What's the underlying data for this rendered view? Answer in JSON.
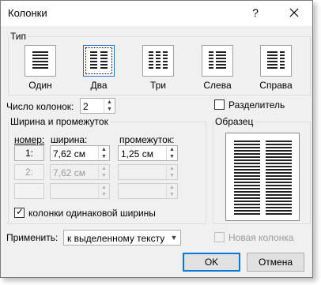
{
  "window": {
    "title": "Колонки",
    "help_label": "?"
  },
  "type_group": {
    "legend": "Тип",
    "presets": [
      {
        "label": "Один"
      },
      {
        "label": "Два",
        "selected": true
      },
      {
        "label": "Три"
      },
      {
        "label": "Слева"
      },
      {
        "label": "Справа"
      }
    ]
  },
  "num_columns": {
    "label": "Число колонок:",
    "value": "2"
  },
  "separator": {
    "label": "Разделитель",
    "checked": false
  },
  "width_group": {
    "legend": "Ширина и промежуток",
    "col_header": "номер:",
    "width_header": "ширина:",
    "spacing_header": "промежуток:",
    "rows": [
      {
        "num": "1:",
        "width": "7,62 см",
        "spacing": "1,25 см",
        "enabled": true
      },
      {
        "num": "2:",
        "width": "7,62 см",
        "spacing": "",
        "enabled": false
      },
      {
        "num": "",
        "width": "",
        "spacing": "",
        "enabled": false
      }
    ],
    "equal_width": {
      "label": "колонки одинаковой ширины",
      "checked": true
    }
  },
  "sample_group": {
    "legend": "Образец"
  },
  "apply": {
    "label": "Применить:",
    "value": "к выделенному тексту"
  },
  "new_column": {
    "label": "Новая колонка",
    "checked": false,
    "enabled": false
  },
  "buttons": {
    "ok": "OK",
    "cancel": "Отмена"
  },
  "colors": {
    "accent": "#0078d7",
    "dialog_bg": "#f0f0f0"
  }
}
